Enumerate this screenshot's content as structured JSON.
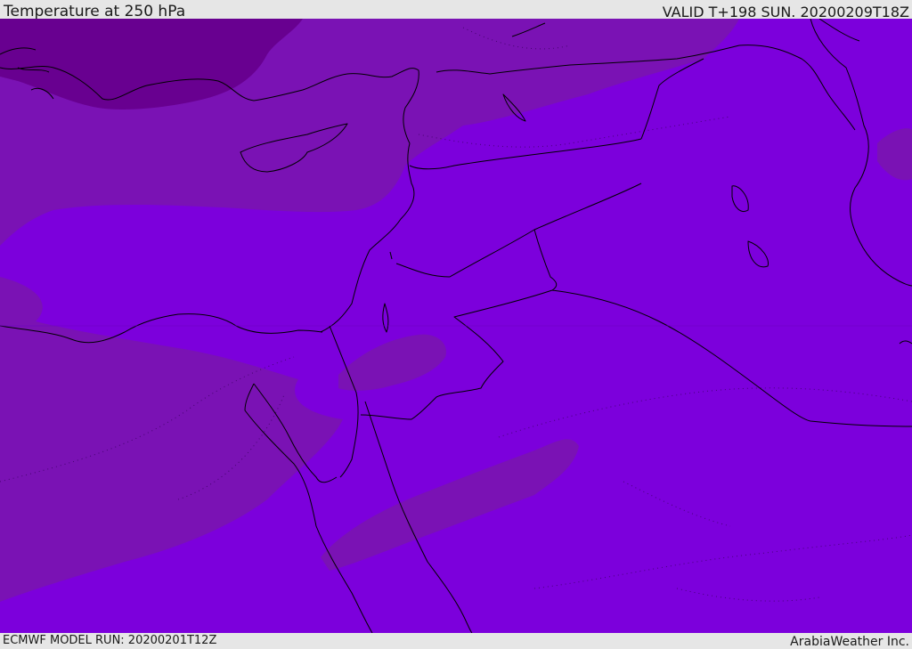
{
  "header": {
    "title": "Temperature at 250 hPa",
    "valid": "VALID T+198 SUN. 20200209T18Z"
  },
  "footer": {
    "model_run": "ECMWF MODEL RUN: 20200201T12Z",
    "credit": "ArabiaWeather Inc."
  },
  "colors": {
    "base_fill": "#7c00dc",
    "mid_band": "#7a12b4",
    "cold_core": "#680090",
    "coastline": "#000000",
    "header_bg": "#e6e6e6"
  }
}
